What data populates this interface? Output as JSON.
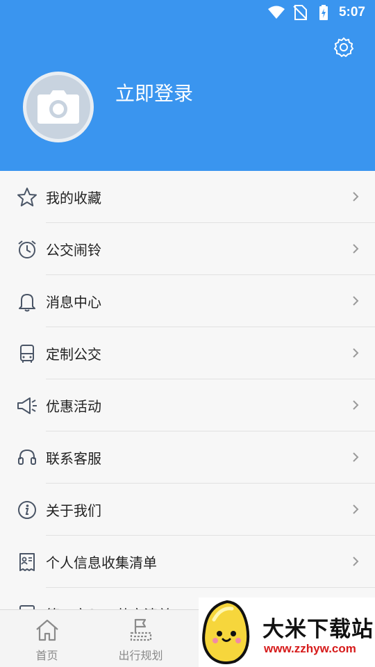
{
  "status_bar": {
    "time": "5:07"
  },
  "header": {
    "login_label": "立即登录",
    "bg_color": "#3a95ef"
  },
  "menu": {
    "items": [
      {
        "label": "我的收藏",
        "icon": "star-icon"
      },
      {
        "label": "公交闹铃",
        "icon": "alarm-clock-icon"
      },
      {
        "label": "消息中心",
        "icon": "bell-icon"
      },
      {
        "label": "定制公交",
        "icon": "bus-icon"
      },
      {
        "label": "优惠活动",
        "icon": "megaphone-icon"
      },
      {
        "label": "联系客服",
        "icon": "headset-icon"
      },
      {
        "label": "关于我们",
        "icon": "info-icon"
      },
      {
        "label": "个人信息收集清单",
        "icon": "id-card-icon"
      },
      {
        "label": "第三方SDK共享清单",
        "icon": "list-icon"
      }
    ]
  },
  "tabbar": {
    "tabs": [
      {
        "label": "首页",
        "icon": "home-icon"
      },
      {
        "label": "出行规划",
        "icon": "route-plan-icon"
      }
    ]
  },
  "watermark": {
    "title": "大米下载站",
    "url": "www.zzhyw.com"
  }
}
